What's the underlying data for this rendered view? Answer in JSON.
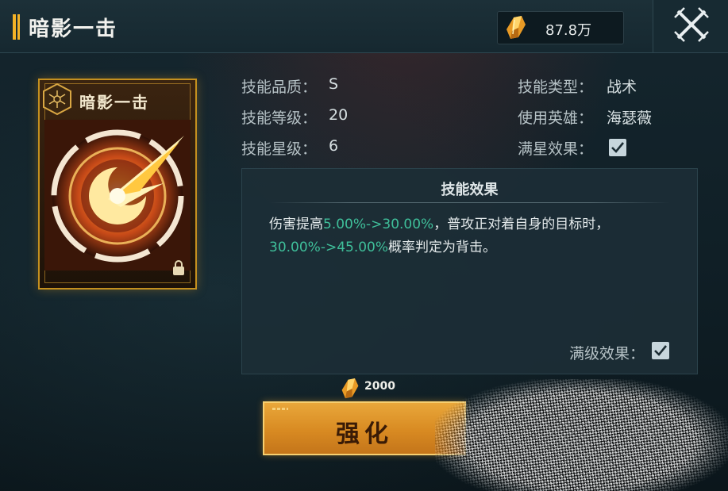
{
  "header": {
    "title": "暗影一击",
    "currency_icon": "gold-crystal-icon",
    "currency_amount": "87.8万",
    "close_icon": "crossed-swords-close-icon"
  },
  "card": {
    "name": "暗影一击",
    "badge_icon": "hexagon-star-badge-icon",
    "art_icon": "shadow-strike-art",
    "lock_icon": "lock-icon"
  },
  "info": {
    "quality_label": "技能品质：",
    "quality_value": "S",
    "level_label": "技能等级：",
    "level_value": "20",
    "star_label": "技能星级：",
    "star_value": "6",
    "type_label": "技能类型：",
    "type_value": "战术",
    "hero_label": "使用英雄：",
    "hero_value": "海瑟薇",
    "fullstar_label": "满星效果：",
    "fullstar_checked": true
  },
  "effect": {
    "title": "技能效果",
    "seg1": "伤害提高",
    "hl1": "5.00%->30.00%",
    "seg2": "，普攻正对着自身的目标时，",
    "hl2": "30.00%->45.00%",
    "seg3": "概率判定为背击。",
    "maxlevel_label": "满级效果：",
    "maxlevel_checked": true,
    "highlight_color": "#3fbf9a"
  },
  "upgrade": {
    "cost_icon": "gold-crystal-icon",
    "cost": "2000",
    "button_label": "强化"
  },
  "colors": {
    "accent_gold": "#f3b227",
    "panel_bg": "#1c2e36"
  }
}
